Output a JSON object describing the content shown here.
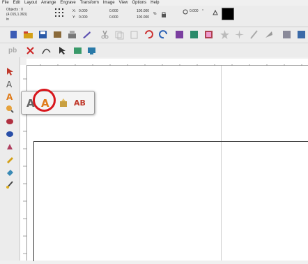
{
  "menubar": [
    "File",
    "Edit",
    "Layout",
    "Arrange",
    "Engrave",
    "Transform",
    "Image",
    "View",
    "Options",
    "Help"
  ],
  "propbar": {
    "objects": "Objects : 0",
    "coords": "(4.015,1.363)",
    "unit": "in",
    "x_label": "X:",
    "x_value": "0.000",
    "y_label": "Y:",
    "y_value": "0.000",
    "w_value": "0.000",
    "h_value": "0.000",
    "scale_w": "100.000",
    "scale_h": "100.000",
    "scale_unit": "%",
    "angle_value": "0.000",
    "angle_unit": "°"
  },
  "text_flyout": {
    "first_tool": "A",
    "highlighted_tool": "A",
    "last_tool": "AB"
  },
  "toolbar2_label": "pb",
  "colors": {
    "highlight": "#d8161c",
    "tool_orange": "#e07b1a"
  }
}
